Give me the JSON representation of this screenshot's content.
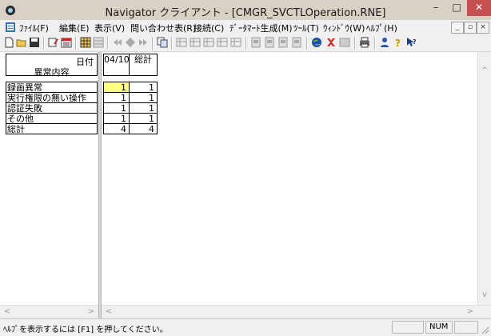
{
  "window": {
    "title": "Navigator クライアント - [CMGR_SVCTLOperation.RNE]",
    "minimize": "–",
    "maximize": "□",
    "close": "✕"
  },
  "menu": {
    "items": [
      "ﾌｧｲﾙ(F)",
      "編集(E)",
      "表示(V)",
      "問い合わせ表(R)",
      "接続(C)",
      "ﾃﾞｰﾀﾏｰﾄ生成(M)",
      "ﾂｰﾙ(T)",
      "ｳｨﾝﾄﾞｳ(W)",
      "ﾍﾙﾌﾟ(H)"
    ],
    "mdi_min": "_",
    "mdi_restore": "▫",
    "mdi_close": "×"
  },
  "toolbar": {
    "icons": [
      "new-file-icon",
      "open-folder-icon",
      "save-icon",
      "properties-icon",
      "calendar-icon",
      "grid-view-icon",
      "chart-view-icon",
      "prev-icon",
      "diamond-icon",
      "next-icon",
      "copy-icon",
      "table-icon-1",
      "table-icon-2",
      "table-icon-3",
      "table-icon-4",
      "table-icon-5",
      "report-icon-1",
      "report-icon-2",
      "report-icon-3",
      "report-icon-4",
      "globe-icon",
      "db-red-icon",
      "panel-icon",
      "print-icon",
      "user-icon",
      "help-icon",
      "context-help-icon"
    ]
  },
  "table": {
    "header_top": "日付",
    "header_bottom": "異常内容",
    "columns": [
      "04/10",
      "総計"
    ],
    "rows": [
      {
        "label": "録画異常",
        "values": [
          "1",
          "1"
        ]
      },
      {
        "label": "実行権限の無い操作",
        "values": [
          "1",
          "1"
        ]
      },
      {
        "label": "認証失敗",
        "values": [
          "1",
          "1"
        ]
      },
      {
        "label": "その他",
        "values": [
          "1",
          "1"
        ]
      },
      {
        "label": "総計",
        "values": [
          "4",
          "4"
        ]
      }
    ],
    "selected_cell_color": "#ffff80"
  },
  "status": {
    "message": "ﾍﾙﾌﾟを表示するには [F1] を押してください。",
    "num": "NUM"
  }
}
